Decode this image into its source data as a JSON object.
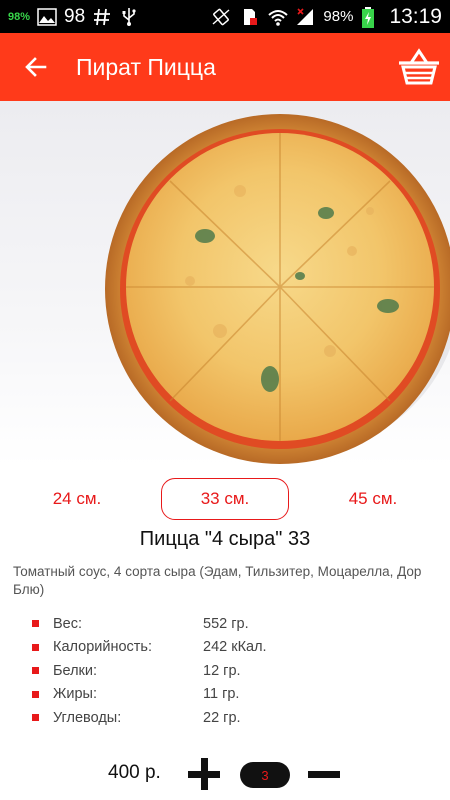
{
  "status_bar": {
    "battery_small": "98%",
    "notif_count": "98",
    "battery_pct": "98%",
    "time": "13:19"
  },
  "app_bar": {
    "title": "Пират Пицца",
    "back_icon": "arrow-left-icon",
    "cart_icon": "basket-icon"
  },
  "product": {
    "image_alt": "pizza-photo",
    "sizes": [
      "24 см.",
      "33 см.",
      "45 см."
    ],
    "selected_size": "33 см.",
    "name": "Пицца \"4 сыра\" 33",
    "description": "Томатный соус, 4 сорта сыра (Эдам, Тильзитер, Моцарелла, Дор Блю)",
    "nutrition": [
      {
        "label": "Вес:",
        "value": "552 гр."
      },
      {
        "label": "Калорийность:",
        "value": "242 кКал."
      },
      {
        "label": "Белки:",
        "value": "12 гр."
      },
      {
        "label": "Жиры:",
        "value": "11 гр."
      },
      {
        "label": "Углеводы:",
        "value": "22 гр."
      }
    ],
    "price": "400 р.",
    "quantity": "3"
  },
  "colors": {
    "accent": "#ff3a1a",
    "red_text": "#e8191a"
  }
}
